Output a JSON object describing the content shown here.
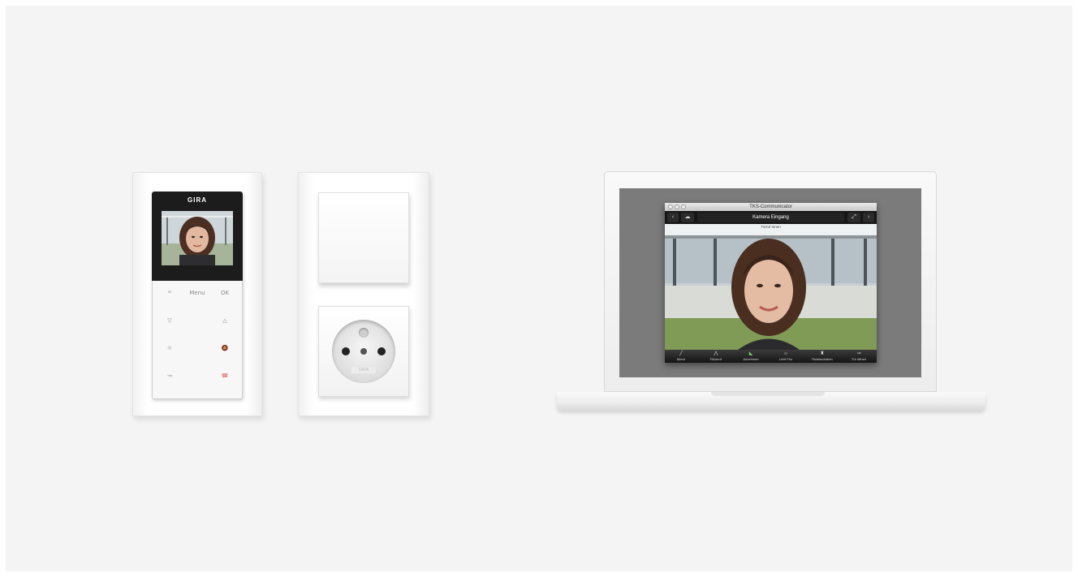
{
  "intercom": {
    "brand": "GIRA",
    "keys": {
      "top_left": "ꟹ",
      "menu": "Menu",
      "ok": "OK",
      "down": "▽",
      "up": "△",
      "light": "☼",
      "mute": "🔕",
      "door": "⊸",
      "hangup": "☎"
    }
  },
  "socket": {
    "label": "GIRA"
  },
  "app": {
    "window_title": "TKS-Communicator",
    "camera_name": "Kamera Eingang",
    "toolbar": {
      "prev": "‹",
      "cloud": "☁",
      "expand": "⤢",
      "next": "›"
    },
    "video_label": "Türruf Innen",
    "bottom_bar": [
      {
        "icon": "╱",
        "label": "Menu"
      },
      {
        "icon": "⋀",
        "label": "Rückruf"
      },
      {
        "icon": "◣",
        "label": "Annehmen",
        "active": true
      },
      {
        "icon": "☼",
        "label": "Licht Flur"
      },
      {
        "icon": "♜",
        "label": "Rufabschalten"
      },
      {
        "icon": "⊸",
        "label": "Tür öffnen"
      }
    ]
  },
  "colors": {
    "background": "#f4f4f4",
    "intercom_head": "#1c1c1c",
    "hangup_red": "#e87a7a",
    "accept_green": "#7bd06d"
  }
}
